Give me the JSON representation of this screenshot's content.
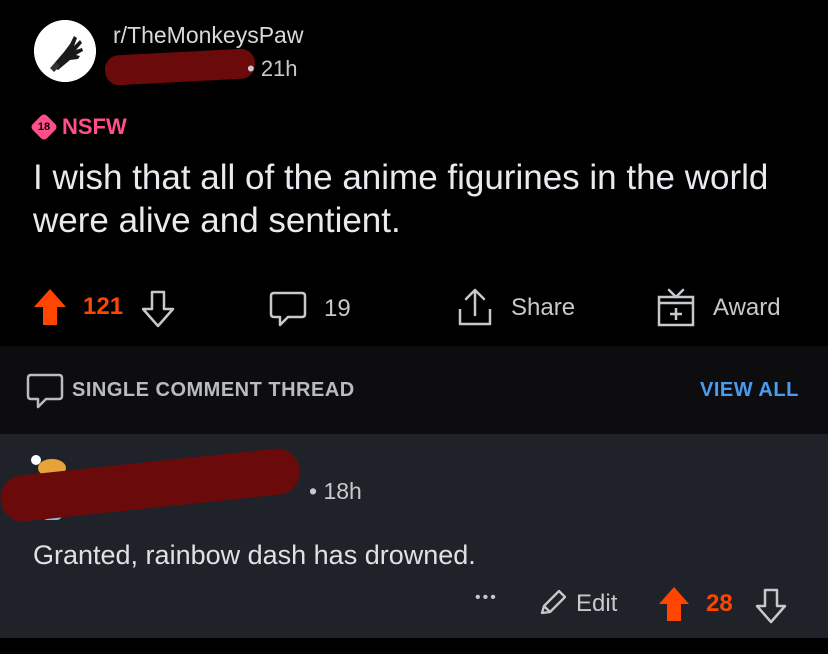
{
  "post": {
    "subreddit": "r/TheMonkeysPaw",
    "time": "• 21h",
    "nsfw_badge_num": "18",
    "nsfw_label": "NSFW",
    "title": "I wish that all of the anime figurines in the world were alive and sentient.",
    "upvotes": "121",
    "comments": "19",
    "share_label": "Share",
    "award_label": "Award"
  },
  "thread": {
    "label": "SINGLE COMMENT THREAD",
    "view_all": "VIEW ALL"
  },
  "comment": {
    "time": "• 18h",
    "body": "Granted, rainbow dash has drowned.",
    "more": "•••",
    "edit_label": "Edit",
    "upvotes": "28"
  },
  "colors": {
    "upvote": "#ff4500",
    "nsfw": "#ff4f8b",
    "link": "#4a9cf0"
  }
}
